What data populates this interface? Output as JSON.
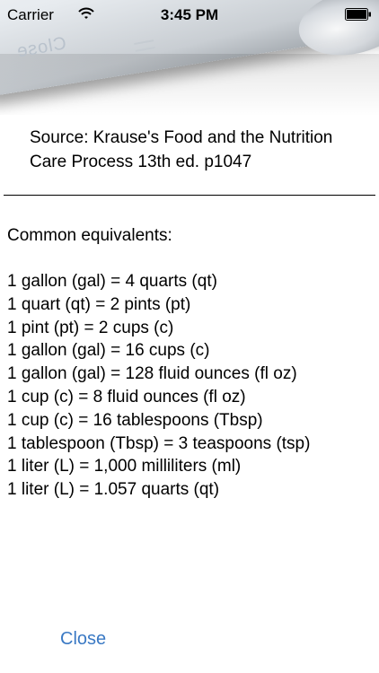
{
  "status_bar": {
    "carrier": "Carrier",
    "time": "3:45 PM",
    "wifi_icon": "wifi-icon",
    "battery_icon": "battery-icon"
  },
  "header": {
    "curl_text": "Close"
  },
  "source": {
    "text": "Source: Krause's Food and the Nutrition Care Process 13th ed. p1047"
  },
  "content": {
    "heading": "Common equivalents:",
    "equivalents": [
      "1 gallon (gal) = 4 quarts (qt)",
      "1 quart (qt) = 2 pints (pt)",
      "1 pint (pt) = 2 cups (c)",
      "1 gallon (gal) = 16 cups (c)",
      "1 gallon (gal) = 128 fluid ounces (fl oz)",
      "1 cup (c) = 8 fluid ounces (fl oz)",
      "1 cup (c) = 16 tablespoons (Tbsp)",
      "1 tablespoon (Tbsp) = 3 teaspoons (tsp)",
      "1 liter (L) = 1,000 milliliters (ml)",
      "1 liter (L) = 1.057 quarts (qt)"
    ]
  },
  "footer": {
    "close_label": "Close"
  },
  "colors": {
    "link": "#3a79c4",
    "text": "#000000",
    "background": "#ffffff"
  }
}
